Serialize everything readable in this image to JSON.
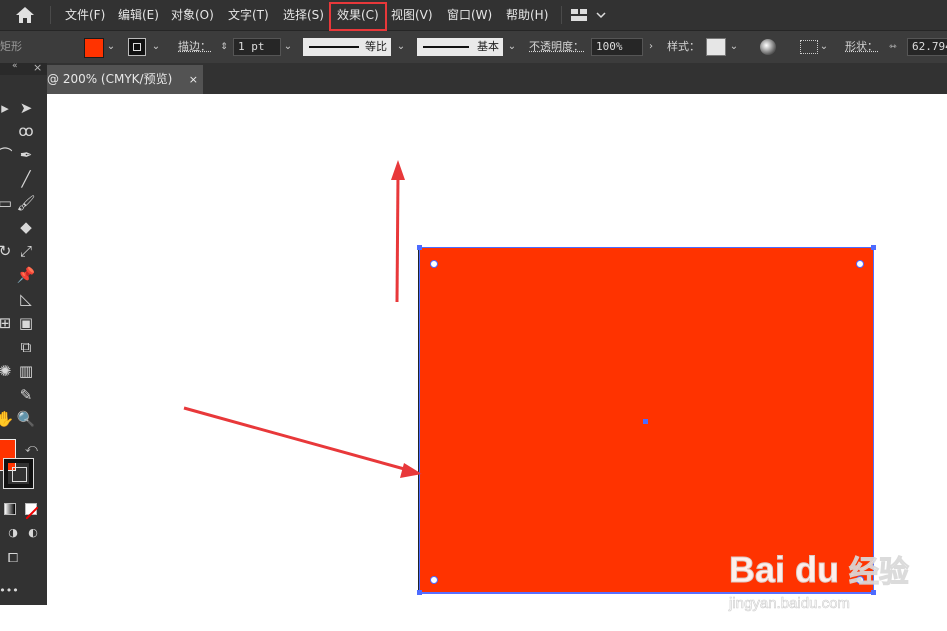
{
  "menubar": {
    "items": [
      {
        "label": "文件(F)"
      },
      {
        "label": "编辑(E)"
      },
      {
        "label": "对象(O)"
      },
      {
        "label": "文字(T)"
      },
      {
        "label": "选择(S)"
      },
      {
        "label": "效果(C)"
      },
      {
        "label": "视图(V)"
      },
      {
        "label": "窗口(W)"
      },
      {
        "label": "帮助(H)"
      }
    ],
    "highlighted_item": "效果(C)",
    "highlight_color": "#e8383a"
  },
  "controlbar": {
    "object_type": "矩形",
    "fill_color": "#ff3300",
    "stroke_label": "描边：",
    "stroke_weight": "1 pt",
    "variable_width_label": "等比",
    "brush_label": "基本",
    "opacity_label": "不透明度：",
    "opacity_value": "100%",
    "style_label": "样式：",
    "shape_label": "形状：",
    "width_value": "62.794"
  },
  "document_tab": {
    "title": "@ 200% (CMYK/预览)",
    "close_glyph": "×"
  },
  "toolbar": {
    "tools_right": [
      "direct-select",
      "lasso",
      "pen",
      "line",
      "paintbrush",
      "eraser",
      "scale",
      "pin",
      "perspective",
      "gradient",
      "shape-builder",
      "chart",
      "eyedropper",
      "zoom"
    ],
    "fill_color": "#ff3300",
    "more_glyph": "•••"
  },
  "canvas": {
    "shape_color": "#ff3300",
    "selection_color": "#4d6bff",
    "annotation_arrow_color": "#e8383a"
  },
  "watermark": {
    "brand": "Bai du",
    "chinese": "经验",
    "url": "jingyan.baidu.com"
  }
}
